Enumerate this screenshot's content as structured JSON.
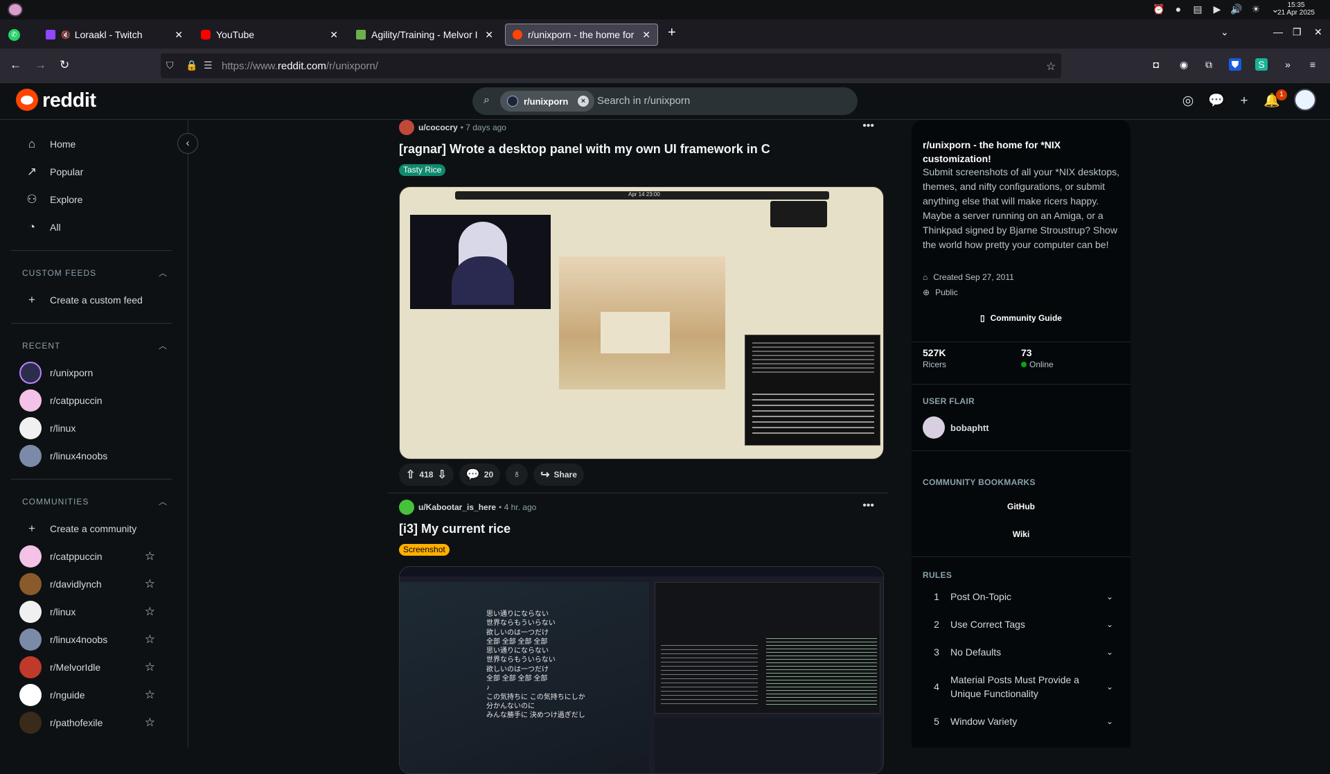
{
  "os": {
    "clock_time": "15:35",
    "clock_date": "21 Apr 2025"
  },
  "tabs": [
    {
      "label": "Loraakl - Twitch",
      "color": "#9146ff",
      "muted": true
    },
    {
      "label": "YouTube",
      "color": "#ff0000"
    },
    {
      "label": "Agility/Training - Melvor I",
      "color": "#6ab04c"
    },
    {
      "label": "r/unixporn - the home for",
      "color": "#ff4500",
      "active": true
    }
  ],
  "browser": {
    "url_prefix": "https://www.",
    "url_host": "reddit.com",
    "url_path": "/r/unixporn/"
  },
  "reddit": {
    "wordmark": "reddit",
    "search_chip": "r/unixporn",
    "search_placeholder": "Search in r/unixporn",
    "notif_count": "1"
  },
  "sidebar": {
    "nav": [
      {
        "label": "Home",
        "icon": "home-icon"
      },
      {
        "label": "Popular",
        "icon": "popular-icon"
      },
      {
        "label": "Explore",
        "icon": "explore-icon"
      },
      {
        "label": "All",
        "icon": "all-icon"
      }
    ],
    "custom_feeds_head": "CUSTOM FEEDS",
    "create_feed": "Create a custom feed",
    "recent_head": "RECENT",
    "recent": [
      {
        "label": "r/unixporn",
        "color": "#2a2e4a"
      },
      {
        "label": "r/catppuccin",
        "color": "#f5c2e7"
      },
      {
        "label": "r/linux",
        "color": "#f0f0f0"
      },
      {
        "label": "r/linux4noobs",
        "color": "#7a8aa8"
      }
    ],
    "communities_head": "COMMUNITIES",
    "create_community": "Create a community",
    "communities": [
      {
        "label": "r/catppuccin",
        "color": "#f5c2e7"
      },
      {
        "label": "r/davidlynch",
        "color": "#8a5a2a"
      },
      {
        "label": "r/linux",
        "color": "#f0f0f0"
      },
      {
        "label": "r/linux4noobs",
        "color": "#7a8aa8"
      },
      {
        "label": "r/MelvorIdle",
        "color": "#c0392b"
      },
      {
        "label": "r/nguide",
        "color": "#ffffff"
      },
      {
        "label": "r/pathofexile",
        "color": "#3a2a1a"
      }
    ]
  },
  "posts": [
    {
      "user": "u/cococry",
      "time": "7 days ago",
      "title": "[ragnar] Wrote a desktop panel with my own UI framework in C",
      "flair": "Tasty Rice",
      "flair_bg": "#0e8a6e",
      "flair_fg": "#ffffff",
      "votes": "418",
      "comments": "20",
      "share": "Share",
      "panel_clock": "Apr 14 23:00"
    },
    {
      "user": "u/Kabootar_is_here",
      "time": "4 hr. ago",
      "title": "[i3] My current rice",
      "flair": "Screenshot",
      "flair_bg": "#ffb000",
      "flair_fg": "#000000",
      "lyrics": [
        "思い通りにならない",
        "世界ならもういらない",
        "欲しいのは一つだけ",
        "全部 全部 全部 全部",
        "思い通りにならない",
        "世界ならもういらない",
        "欲しいのは一つだけ",
        "全部 全部 全部 全部",
        "♪",
        "この気持ちに この気持ちにしか",
        "分かんないのに",
        "みんな勝手に 決めつけ過ぎだし"
      ]
    }
  ],
  "about": {
    "title": "r/unixporn - the home for *NIX customization!",
    "description": "Submit screenshots of all your *NIX desktops, themes, and nifty configurations, or submit anything else that will make ricers happy. Maybe a server running on an Amiga, or a Thinkpad signed by Bjarne Stroustrup? Show the world how pretty your computer can be!",
    "created": "Created Sep 27, 2011",
    "visibility": "Public",
    "guide": "Community Guide",
    "members": "527K",
    "members_label": "Ricers",
    "online": "73",
    "online_label": "Online",
    "flair_head": "USER FLAIR",
    "flair_user": "bobaphtt",
    "bookmarks_head": "COMMUNITY BOOKMARKS",
    "bookmarks": [
      "GitHub",
      "Wiki"
    ],
    "rules_head": "RULES",
    "rules": [
      {
        "num": "1",
        "text": "Post On-Topic"
      },
      {
        "num": "2",
        "text": "Use Correct Tags"
      },
      {
        "num": "3",
        "text": "No Defaults"
      },
      {
        "num": "4",
        "text": "Material Posts Must Provide a Unique Functionality"
      },
      {
        "num": "5",
        "text": "Window Variety"
      }
    ]
  }
}
